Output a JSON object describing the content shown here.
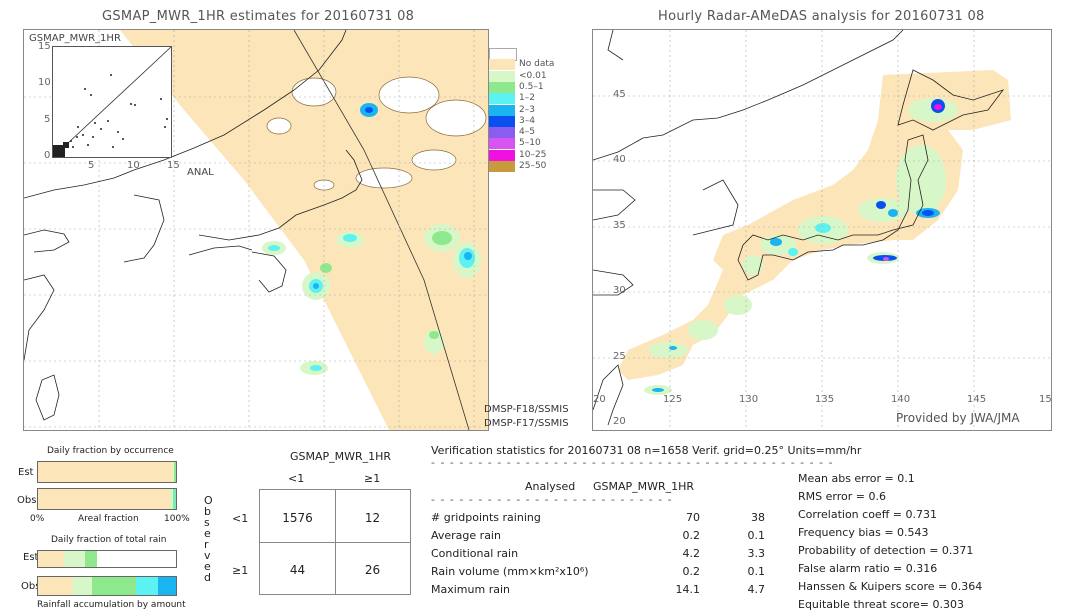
{
  "left_map": {
    "title": "GSMAP_MWR_1HR estimates for 20160731 08",
    "inset_label": "GSMAP_MWR_1HR",
    "inset_y_ticks": [
      "15",
      "10",
      "5",
      "0"
    ],
    "inset_x_ticks": [
      "5",
      "10",
      "15"
    ],
    "inset_x_axis_label": "ANAL",
    "satellites": [
      "DMSP-F18/SSMIS",
      "DMSP-F17/SSMIS"
    ]
  },
  "legend": {
    "items": [
      {
        "label": "",
        "color": "#ffffff"
      },
      {
        "label": "No data",
        "color": "#fce5b8"
      },
      {
        "label": "<0.01",
        "color": "#d8f7c8"
      },
      {
        "label": "0.5–1",
        "color": "#8ee88e"
      },
      {
        "label": "1–2",
        "color": "#5cf2f2"
      },
      {
        "label": "2–3",
        "color": "#1ab4f0"
      },
      {
        "label": "3–4",
        "color": "#0a50f0"
      },
      {
        "label": "4–5",
        "color": "#8a5cf0"
      },
      {
        "label": "5–10",
        "color": "#d655f0"
      },
      {
        "label": "10–25",
        "color": "#f010e0"
      },
      {
        "label": "25–50",
        "color": "#c89a3c"
      }
    ]
  },
  "right_map": {
    "title": "Hourly Radar-AMeDAS analysis for 20160731 08",
    "lat_ticks": [
      "45",
      "40",
      "35",
      "30",
      "25",
      "20"
    ],
    "lon_ticks": [
      "20",
      "125",
      "130",
      "135",
      "140",
      "145",
      "15"
    ],
    "credit": "Provided by JWA/JMA"
  },
  "occurrence_panel": {
    "title": "Daily fraction by occurrence",
    "rows": [
      {
        "label": "Est",
        "segments": [
          {
            "color": "#fce5b8",
            "fraction": 0.977
          },
          {
            "color": "#d8f7c8",
            "fraction": 0.008
          },
          {
            "color": "#8ee88e",
            "fraction": 0.015
          }
        ]
      },
      {
        "label": "Obs",
        "segments": [
          {
            "color": "#fce5b8",
            "fraction": 0.958
          },
          {
            "color": "#d8f7c8",
            "fraction": 0.02
          },
          {
            "color": "#8ee88e",
            "fraction": 0.012
          },
          {
            "color": "#5cf2f2",
            "fraction": 0.01
          }
        ]
      }
    ],
    "axis_left": "0%",
    "axis_label": "Areal fraction",
    "axis_right": "100%"
  },
  "total_rain_panel": {
    "title": "Daily fraction of total rain",
    "rows": [
      {
        "label": "Est",
        "segments": [
          {
            "color": "#fce5b8",
            "fraction": 0.19
          },
          {
            "color": "#d8f7c8",
            "fraction": 0.15
          },
          {
            "color": "#8ee88e",
            "fraction": 0.09
          }
        ]
      },
      {
        "label": "Obs",
        "segments": [
          {
            "color": "#fce5b8",
            "fraction": 0.25
          },
          {
            "color": "#d8f7c8",
            "fraction": 0.14
          },
          {
            "color": "#8ee88e",
            "fraction": 0.32
          },
          {
            "color": "#5cf2f2",
            "fraction": 0.16
          },
          {
            "color": "#1ab4f0",
            "fraction": 0.13
          }
        ]
      }
    ],
    "axis_label": "Rainfall accumulation by amount"
  },
  "contingency": {
    "title": "GSMAP_MWR_1HR",
    "col_headers": [
      "<1",
      "≥1"
    ],
    "row_headers": [
      "<1",
      "≥1"
    ],
    "observed_label": "Observed",
    "cells": [
      [
        "1576",
        "12"
      ],
      [
        "44",
        "26"
      ]
    ]
  },
  "verification": {
    "header": "Verification statistics for 20160731 08   n=1658   Verif. grid=0.25°   Units=mm/hr",
    "col_analysed": "Analysed",
    "col_est": "GSMAP_MWR_1HR",
    "rows": [
      {
        "label": "# gridpoints raining",
        "analysed": "70",
        "est": "38"
      },
      {
        "label": "Average rain",
        "analysed": "0.2",
        "est": "0.1"
      },
      {
        "label": "Conditional rain",
        "analysed": "4.2",
        "est": "3.3"
      },
      {
        "label": "Rain volume (mm×km²x10⁶)",
        "analysed": "0.2",
        "est": "0.1"
      },
      {
        "label": "Maximum rain",
        "analysed": "14.1",
        "est": "4.7"
      }
    ],
    "scores": [
      "Mean abs error = 0.1",
      "RMS error = 0.6",
      "Correlation coeff = 0.731",
      "Frequency bias = 0.543",
      "Probability of detection = 0.371",
      "False alarm ratio = 0.316",
      "Hanssen & Kuipers score = 0.364",
      "Equitable threat score= 0.303"
    ]
  }
}
